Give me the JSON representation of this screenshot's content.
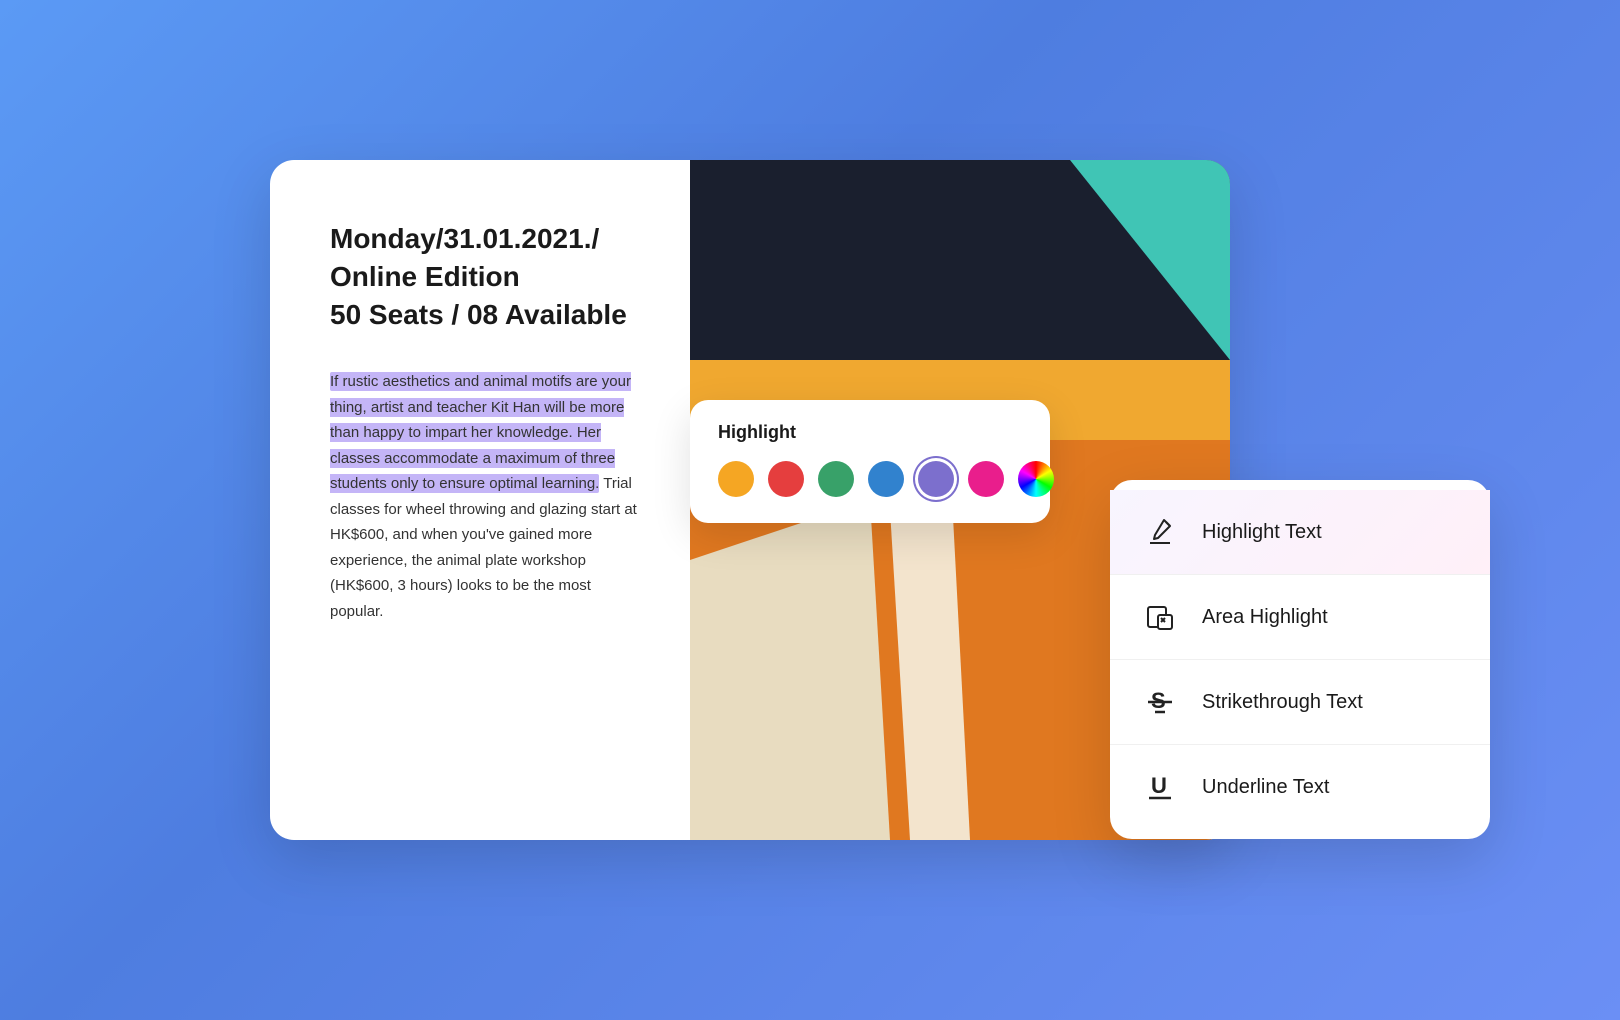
{
  "doc": {
    "title": "Monday/31.01.2021./\nOnline Edition\n50 Seats / 08 Available",
    "body_part1": "If rustic aesthetics and animal motifs are your thing, artist and teacher Kit Han will be more than happy to impart her knowledge. Her classes accommodate a maximum of three students only to ensure optimal learning.",
    "body_part2": " Trial classes for wheel throwing and glazing start at HK$600, and when you've gained more experience, the animal plate workshop (HK$600, 3 hours) looks to be the most popular."
  },
  "highlight_picker": {
    "title": "Highlight",
    "colors": [
      {
        "name": "yellow",
        "value": "#f5a623"
      },
      {
        "name": "red",
        "value": "#e53e3e"
      },
      {
        "name": "green",
        "value": "#38a169"
      },
      {
        "name": "blue",
        "value": "#3182ce"
      },
      {
        "name": "purple",
        "value": "#7c6fcd",
        "selected": true
      },
      {
        "name": "pink",
        "value": "#e91e8c"
      },
      {
        "name": "rainbow",
        "value": "conic"
      }
    ]
  },
  "context_menu": {
    "items": [
      {
        "id": "highlight-text",
        "label": "Highlight Text",
        "active": true
      },
      {
        "id": "area-highlight",
        "label": "Area Highlight",
        "active": false
      },
      {
        "id": "strikethrough-text",
        "label": "Strikethrough Text",
        "active": false
      },
      {
        "id": "underline-text",
        "label": "Underline Text",
        "active": false
      }
    ]
  },
  "colors": {
    "background_start": "#5b9af5",
    "background_end": "#6b8ff5",
    "highlight": "#c4b5f7"
  }
}
